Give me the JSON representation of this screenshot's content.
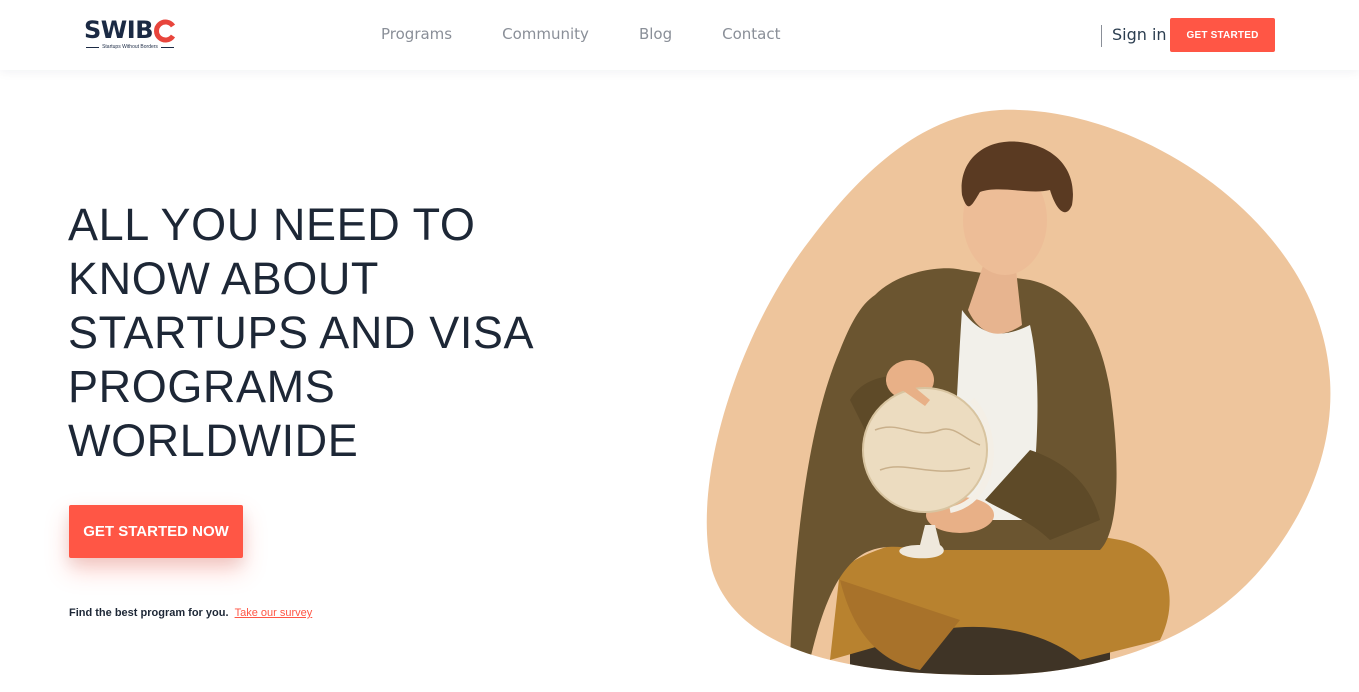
{
  "header": {
    "logo": {
      "wordmark": "SWIB",
      "tagline": "Startups Without Borders"
    },
    "nav": [
      {
        "label": "Programs"
      },
      {
        "label": "Community"
      },
      {
        "label": "Blog"
      },
      {
        "label": "Contact"
      }
    ],
    "sign_in": "Sign in",
    "cta": "GET STARTED"
  },
  "hero": {
    "title_lines": [
      "ALL YOU NEED TO",
      "KNOW ABOUT",
      "STARTUPS AND VISA",
      "PROGRAMS",
      "WORLDWIDE"
    ],
    "cta": "GET STARTED NOW",
    "survey_text": "Find the best program for you.",
    "survey_link": "Take our survey",
    "image_desc_icon": "man-with-globe-photo"
  },
  "colors": {
    "accent": "#ff5645",
    "heading": "#1d2736",
    "nav_text": "#8a8f98",
    "logo": "#1b2a44",
    "blob": "#eec59c"
  }
}
